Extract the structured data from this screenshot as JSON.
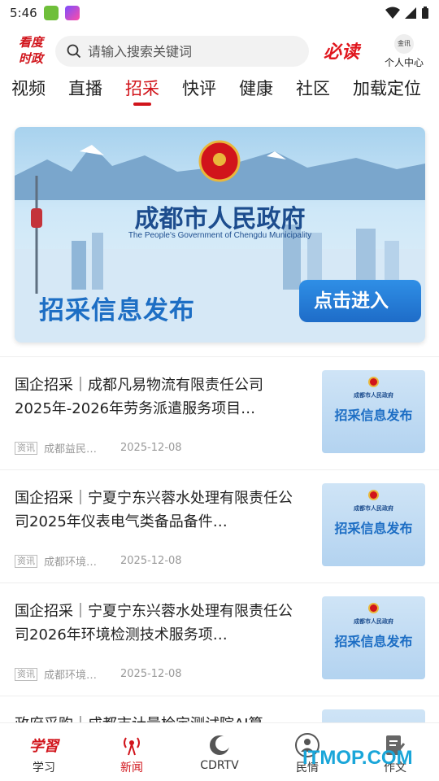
{
  "status": {
    "time": "5:46"
  },
  "header": {
    "logo_text": "看度时政",
    "search_placeholder": "请输入搜索关键词",
    "bidu_label": "必读",
    "user_avatar": "金讯",
    "user_label": "个人中心"
  },
  "tabs": [
    {
      "label": "视频"
    },
    {
      "label": "直播"
    },
    {
      "label": "招采",
      "active": true
    },
    {
      "label": "快评"
    },
    {
      "label": "健康"
    },
    {
      "label": "社区"
    },
    {
      "label": "加载定位"
    }
  ],
  "banner": {
    "title": "成都市人民政府",
    "subtitle": "The People's Government of Chengdu Municipality",
    "headline": "招采信息发布",
    "button": "点击进入"
  },
  "articles": [
    {
      "title": "国企招采｜成都凡易物流有限责任公司2025年-2026年劳务派遣服务项目…",
      "tag": "资讯",
      "source": "成都益民…",
      "date": "2025-12-08",
      "thumb_small": "成都市人民政府",
      "thumb_big": "招采信息发布"
    },
    {
      "title": "国企招采｜宁夏宁东兴蓉水处理有限责任公司2025年仪表电气类备品备件…",
      "tag": "资讯",
      "source": "成都环境…",
      "date": "2025-12-08",
      "thumb_small": "成都市人民政府",
      "thumb_big": "招采信息发布"
    },
    {
      "title": "国企招采｜宁夏宁东兴蓉水处理有限责任公司2026年环境检测技术服务项…",
      "tag": "资讯",
      "source": "成都环境…",
      "date": "2025-12-08",
      "thumb_small": "成都市人民政府",
      "thumb_big": "招采信息发布"
    },
    {
      "title": "政府采购｜成都市计量检定测试院AI算",
      "tag": "",
      "source": "",
      "date": "",
      "thumb_small": "",
      "thumb_big": ""
    }
  ],
  "bottom_nav": [
    {
      "label": "学习",
      "icon": "study-icon"
    },
    {
      "label": "新闻",
      "icon": "news-broadcast-icon",
      "active": true
    },
    {
      "label": "CDRTV",
      "icon": "cdrtv-icon"
    },
    {
      "label": "民情",
      "icon": "people-icon"
    },
    {
      "label": "作文",
      "icon": "compose-icon"
    }
  ],
  "watermark": "ITMOP.COM",
  "colors": {
    "accent": "#d1141b",
    "brand_blue": "#1d6ec4"
  }
}
